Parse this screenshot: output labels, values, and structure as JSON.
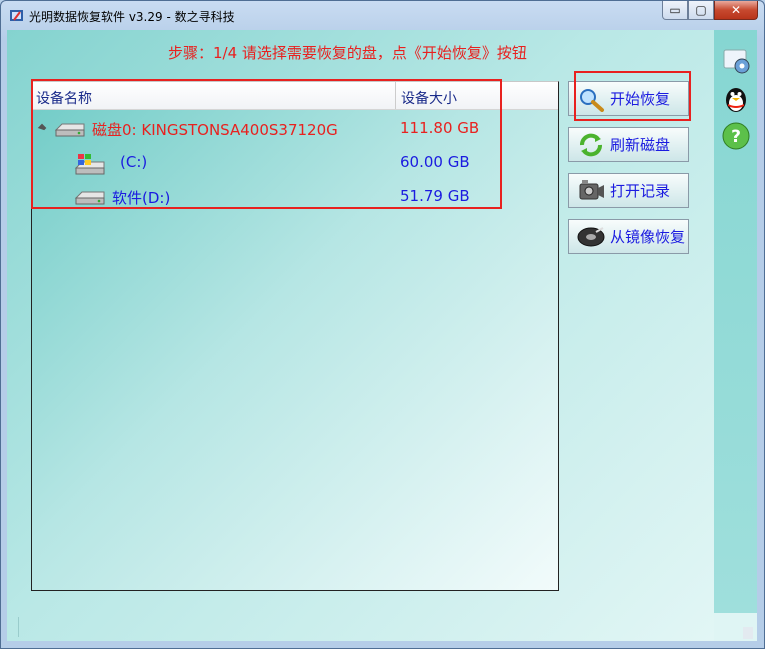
{
  "window": {
    "title": "光明数据恢复软件 v3.29 - 数之寻科技",
    "minimize_glyph": "▭",
    "maximize_glyph": "▢",
    "close_glyph": "✕"
  },
  "step_text": "步骤：1/4 请选择需要恢复的盘，点《开始恢复》按钮",
  "tree": {
    "columns": [
      "设备名称",
      "设备大小"
    ],
    "rows": [
      {
        "name": "磁盘0: KINGSTONSA400S37120G",
        "size": "111.80 GB",
        "icon": "hard-disk-icon"
      },
      {
        "name": "(C:)",
        "size": "60.00 GB",
        "icon": "windows-drive-icon"
      },
      {
        "name": "软件(D:)",
        "size": "51.79 GB",
        "icon": "drive-icon"
      }
    ]
  },
  "buttons": {
    "start": "开始恢复",
    "refresh": "刷新磁盘",
    "open_record": "打开记录",
    "from_image": "从镜像恢复"
  },
  "colors": {
    "accent_red": "#e8211f",
    "link_blue": "#1b1be0"
  }
}
